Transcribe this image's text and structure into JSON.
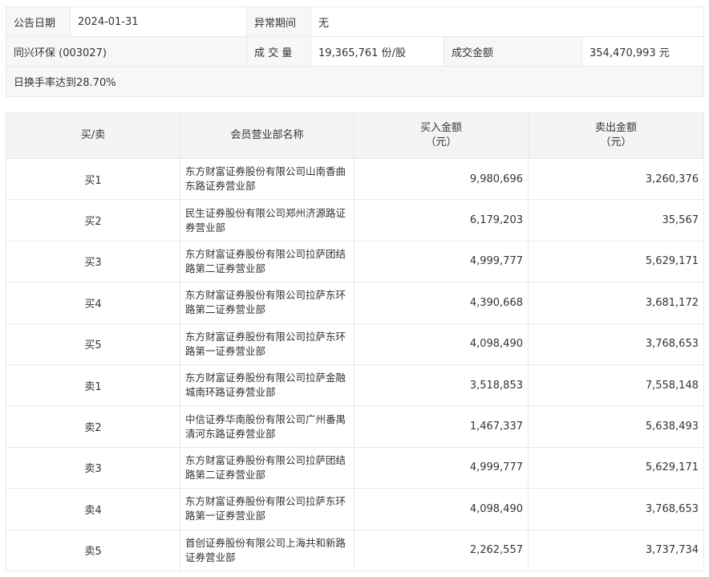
{
  "info": {
    "date_label": "公告日期",
    "date_value": "2024-01-31",
    "period_label": "异常期间",
    "period_value": "无",
    "stock": "同兴环保 (003027)",
    "volume_label": "成 交 量",
    "volume_value": "19,365,761 份/股",
    "amount_label": "成交金额",
    "amount_value": "354,470,993 元",
    "reason": "日换手率达到28.70%"
  },
  "table": {
    "headers": {
      "direction": "买/卖",
      "broker": "会员营业部名称",
      "buy_line1": "买入金额",
      "buy_line2": "（元）",
      "sell_line1": "卖出金额",
      "sell_line2": "（元）"
    },
    "rows": [
      {
        "dir": "买1",
        "name": "东方财富证券股份有限公司山南香曲东路证券营业部",
        "buy": "9,980,696",
        "sell": "3,260,376"
      },
      {
        "dir": "买2",
        "name": "民生证券股份有限公司郑州济源路证券营业部",
        "buy": "6,179,203",
        "sell": "35,567"
      },
      {
        "dir": "买3",
        "name": "东方财富证券股份有限公司拉萨团结路第二证券营业部",
        "buy": "4,999,777",
        "sell": "5,629,171"
      },
      {
        "dir": "买4",
        "name": "东方财富证券股份有限公司拉萨东环路第二证券营业部",
        "buy": "4,390,668",
        "sell": "3,681,172"
      },
      {
        "dir": "买5",
        "name": "东方财富证券股份有限公司拉萨东环路第一证券营业部",
        "buy": "4,098,490",
        "sell": "3,768,653"
      },
      {
        "dir": "卖1",
        "name": "东方财富证券股份有限公司拉萨金融城南环路证券营业部",
        "buy": "3,518,853",
        "sell": "7,558,148"
      },
      {
        "dir": "卖2",
        "name": "中信证券华南股份有限公司广州番禺清河东路证券营业部",
        "buy": "1,467,337",
        "sell": "5,638,493"
      },
      {
        "dir": "卖3",
        "name": "东方财富证券股份有限公司拉萨团结路第二证券营业部",
        "buy": "4,999,777",
        "sell": "5,629,171"
      },
      {
        "dir": "卖4",
        "name": "东方财富证券股份有限公司拉萨东环路第一证券营业部",
        "buy": "4,098,490",
        "sell": "3,768,653"
      },
      {
        "dir": "卖5",
        "name": "首创证券股份有限公司上海共和新路证券营业部",
        "buy": "2,262,557",
        "sell": "3,737,734"
      }
    ]
  }
}
